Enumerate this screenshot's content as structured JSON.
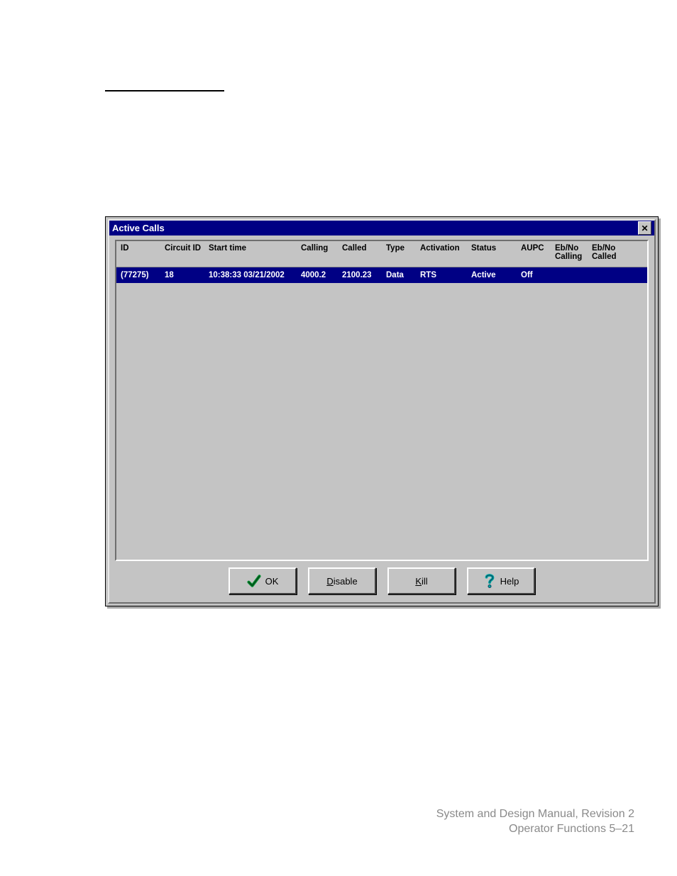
{
  "dialog": {
    "title": "Active Calls",
    "close_x": "✕",
    "headers": {
      "id": "ID",
      "circuit_id": "Circuit ID",
      "start_time": "Start time",
      "calling": "Calling",
      "called": "Called",
      "type": "Type",
      "activation": "Activation",
      "status": "Status",
      "aupc": "AUPC",
      "ebno_calling": "Eb/No\nCalling",
      "ebno_called": "Eb/No\nCalled"
    },
    "rows": [
      {
        "id": "(77275)",
        "circuit_id": "18",
        "start_time": "10:38:33 03/21/2002",
        "calling": "4000.2",
        "called": "2100.23",
        "type": "Data",
        "activation": "RTS",
        "status": "Active",
        "aupc": "Off",
        "ebno_calling": "",
        "ebno_called": ""
      }
    ],
    "buttons": {
      "ok": "OK",
      "disable_first": "D",
      "disable_rest": "isable",
      "kill_first": "K",
      "kill_rest": "ill",
      "help": " Help"
    }
  },
  "footer": {
    "line1": "System and Design Manual, Revision 2",
    "line2": "Operator Functions  5–21"
  }
}
